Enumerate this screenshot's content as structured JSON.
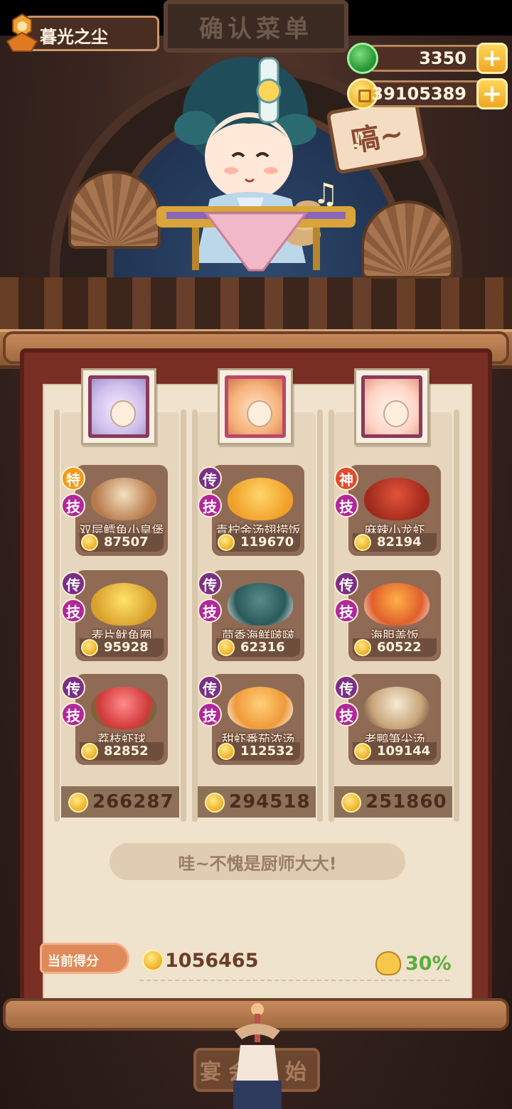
{
  "header": {
    "sign_text": "确认菜单",
    "player_name": "暮光之尘",
    "jade": "3350",
    "coins": "39105389"
  },
  "character": {
    "speech": "嗃~"
  },
  "columns": [
    {
      "portrait": "silver",
      "total": "266287",
      "dishes": [
        {
          "rank": "特",
          "rank_color": "#f29a1c",
          "skill": "技",
          "name": "双层鳕鱼小皇堡",
          "price": "87507"
        },
        {
          "rank": "传",
          "rank_color": "#7b2f88",
          "skill": "技",
          "name": "麦片鱿鱼圈",
          "price": "95928"
        },
        {
          "rank": "传",
          "rank_color": "#7b2f88",
          "skill": "技",
          "name": "荔枝虾球",
          "price": "82852"
        }
      ]
    },
    {
      "portrait": "gold",
      "total": "294518",
      "dishes": [
        {
          "rank": "传",
          "rank_color": "#7b2f88",
          "skill": "技",
          "name": "青柠金汤翅捞饭",
          "price": "119670"
        },
        {
          "rank": "传",
          "rank_color": "#7b2f88",
          "skill": "技",
          "name": "茴香海鲜啵啵",
          "price": "62316"
        },
        {
          "rank": "传",
          "rank_color": "#7b2f88",
          "skill": "技",
          "name": "甜虾番茄浓汤",
          "price": "112532"
        }
      ]
    },
    {
      "portrait": "white",
      "total": "251860",
      "dishes": [
        {
          "rank": "神",
          "rank_color": "#e24a2c",
          "skill": "技",
          "name": "麻辣小龙虾",
          "price": "82194"
        },
        {
          "rank": "传",
          "rank_color": "#7b2f88",
          "skill": "技",
          "name": "海胆盖饭",
          "price": "60522"
        },
        {
          "rank": "传",
          "rank_color": "#7b2f88",
          "skill": "技",
          "name": "老鸭笋尖汤",
          "price": "109144"
        }
      ]
    }
  ],
  "praise": "哇~不愧是厨师大大!",
  "score": {
    "label": "当前得分",
    "value": "1056465",
    "bonus": "30%"
  },
  "start_button": "宴会开始"
}
